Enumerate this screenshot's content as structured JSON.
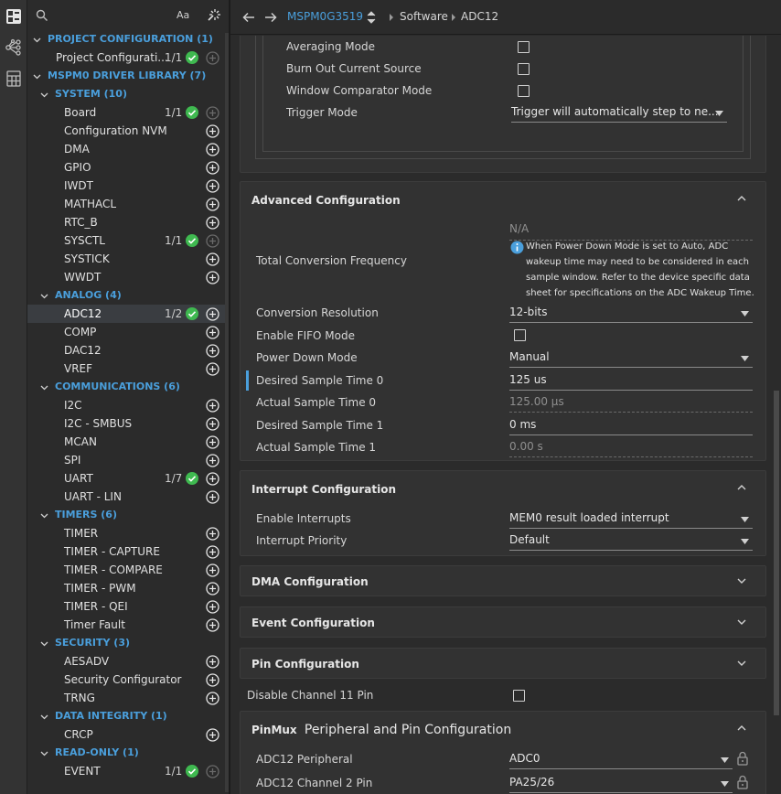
{
  "sidebar": {
    "search_placeholder": "",
    "case_toggle": "Aa",
    "tree": [
      {
        "kind": "cat",
        "label": "PROJECT CONFIGURATION (1)",
        "indent": 0
      },
      {
        "kind": "item",
        "label": "Project Configurati...",
        "count": "1/1",
        "ok": true,
        "add": "dim",
        "indent": 1
      },
      {
        "kind": "cat",
        "label": "MSPM0 DRIVER LIBRARY (7)",
        "indent": 0
      },
      {
        "kind": "cat",
        "label": "SYSTEM (10)",
        "indent": 1
      },
      {
        "kind": "item",
        "label": "Board",
        "count": "1/1",
        "ok": true,
        "add": "dim",
        "indent": 2
      },
      {
        "kind": "item",
        "label": "Configuration NVM",
        "add": "on",
        "indent": 2
      },
      {
        "kind": "item",
        "label": "DMA",
        "add": "on",
        "indent": 2
      },
      {
        "kind": "item",
        "label": "GPIO",
        "add": "on",
        "indent": 2
      },
      {
        "kind": "item",
        "label": "IWDT",
        "add": "on",
        "indent": 2
      },
      {
        "kind": "item",
        "label": "MATHACL",
        "add": "on",
        "indent": 2
      },
      {
        "kind": "item",
        "label": "RTC_B",
        "add": "on",
        "indent": 2
      },
      {
        "kind": "item",
        "label": "SYSCTL",
        "count": "1/1",
        "ok": true,
        "add": "dim",
        "indent": 2
      },
      {
        "kind": "item",
        "label": "SYSTICK",
        "add": "on",
        "indent": 2
      },
      {
        "kind": "item",
        "label": "WWDT",
        "add": "on",
        "indent": 2
      },
      {
        "kind": "cat",
        "label": "ANALOG (4)",
        "indent": 1
      },
      {
        "kind": "item",
        "label": "ADC12",
        "count": "1/2",
        "ok": true,
        "add": "on",
        "indent": 2,
        "selected": true
      },
      {
        "kind": "item",
        "label": "COMP",
        "add": "on",
        "indent": 2
      },
      {
        "kind": "item",
        "label": "DAC12",
        "add": "on",
        "indent": 2
      },
      {
        "kind": "item",
        "label": "VREF",
        "add": "on",
        "indent": 2
      },
      {
        "kind": "cat",
        "label": "COMMUNICATIONS (6)",
        "indent": 1
      },
      {
        "kind": "item",
        "label": "I2C",
        "add": "on",
        "indent": 2
      },
      {
        "kind": "item",
        "label": "I2C - SMBUS",
        "add": "on",
        "indent": 2
      },
      {
        "kind": "item",
        "label": "MCAN",
        "add": "on",
        "indent": 2
      },
      {
        "kind": "item",
        "label": "SPI",
        "add": "on",
        "indent": 2
      },
      {
        "kind": "item",
        "label": "UART",
        "count": "1/7",
        "ok": true,
        "add": "on",
        "indent": 2
      },
      {
        "kind": "item",
        "label": "UART - LIN",
        "add": "on",
        "indent": 2
      },
      {
        "kind": "cat",
        "label": "TIMERS (6)",
        "indent": 1
      },
      {
        "kind": "item",
        "label": "TIMER",
        "add": "on",
        "indent": 2
      },
      {
        "kind": "item",
        "label": "TIMER - CAPTURE",
        "add": "on",
        "indent": 2
      },
      {
        "kind": "item",
        "label": "TIMER - COMPARE",
        "add": "on",
        "indent": 2
      },
      {
        "kind": "item",
        "label": "TIMER - PWM",
        "add": "on",
        "indent": 2
      },
      {
        "kind": "item",
        "label": "TIMER - QEI",
        "add": "on",
        "indent": 2
      },
      {
        "kind": "item",
        "label": "Timer Fault",
        "add": "on",
        "indent": 2
      },
      {
        "kind": "cat",
        "label": "SECURITY (3)",
        "indent": 1
      },
      {
        "kind": "item",
        "label": "AESADV",
        "add": "on",
        "indent": 2
      },
      {
        "kind": "item",
        "label": "Security Configurator",
        "add": "on",
        "indent": 2
      },
      {
        "kind": "item",
        "label": "TRNG",
        "add": "on",
        "indent": 2
      },
      {
        "kind": "cat",
        "label": "DATA INTEGRITY (1)",
        "indent": 1
      },
      {
        "kind": "item",
        "label": "CRCP",
        "add": "on",
        "indent": 2
      },
      {
        "kind": "cat",
        "label": "READ-ONLY (1)",
        "indent": 1
      },
      {
        "kind": "item",
        "label": "EVENT",
        "count": "1/1",
        "ok": true,
        "add": "dim",
        "indent": 2
      }
    ]
  },
  "topbar": {
    "device": "MSPM0G3519",
    "crumbs": [
      "Software",
      "ADC12"
    ]
  },
  "top_section": {
    "rows": [
      {
        "label": "Averaging Mode",
        "type": "check"
      },
      {
        "label": "Burn Out Current Source",
        "type": "check"
      },
      {
        "label": "Window Comparator Mode",
        "type": "check"
      },
      {
        "label": "Trigger Mode",
        "type": "select",
        "value": "Trigger will automatically step to ne..."
      }
    ]
  },
  "advanced": {
    "title": "Advanced Configuration",
    "total_conv_label": "Total Conversion Frequency",
    "total_conv_value": "N/A",
    "info_lines": [
      "When Power Down Mode is set to Auto, ADC",
      "wakeup time may need to be considered in each",
      "sample window. Refer to the device specific data",
      "sheet for specifications on the ADC Wakeup Time."
    ],
    "rows": [
      {
        "label": "Conversion Resolution",
        "type": "select",
        "value": "12-bits"
      },
      {
        "label": "Enable FIFO Mode",
        "type": "check"
      },
      {
        "label": "Power Down Mode",
        "type": "select",
        "value": "Manual"
      },
      {
        "label": "Desired Sample Time 0",
        "type": "text",
        "value": "125 us",
        "modified": true
      },
      {
        "label": "Actual Sample Time 0",
        "type": "ro",
        "value": "125.00 µs"
      },
      {
        "label": "Desired Sample Time 1",
        "type": "text",
        "value": "0 ms"
      },
      {
        "label": "Actual Sample Time 1",
        "type": "ro",
        "value": "0.00 s"
      }
    ]
  },
  "interrupt": {
    "title": "Interrupt Configuration",
    "rows": [
      {
        "label": "Enable Interrupts",
        "type": "select",
        "value": "MEM0 result loaded interrupt"
      },
      {
        "label": "Interrupt Priority",
        "type": "select",
        "value": "Default"
      }
    ]
  },
  "collapsed_panels": [
    "DMA Configuration",
    "Event Configuration",
    "Pin Configuration"
  ],
  "disable_channel": {
    "label": "Disable Channel 11 Pin"
  },
  "pinmux": {
    "title_bold": "PinMux",
    "title_rest": "Peripheral and Pin Configuration",
    "rows": [
      {
        "label": "ADC12 Peripheral",
        "type": "select",
        "value": "ADC0",
        "lock": true
      },
      {
        "label": "ADC12 Channel 2 Pin",
        "type": "select",
        "value": "PA25/26",
        "lock": true
      }
    ]
  },
  "colors": {
    "accent": "#4a9fdc",
    "ok_green": "#3fb950",
    "panel_bg": "#323232",
    "page_bg": "#2b2b2b"
  }
}
